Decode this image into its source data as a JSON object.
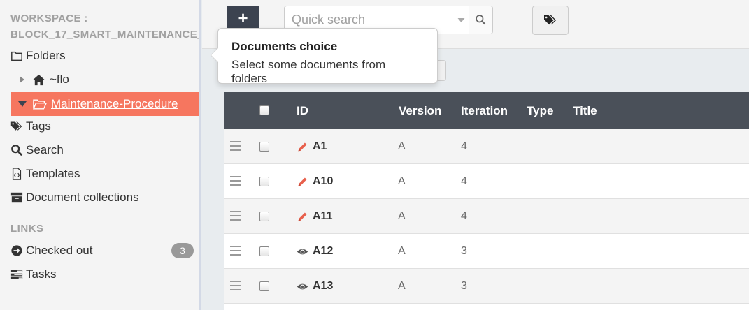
{
  "workspace": {
    "title_line1": "WORKSPACE :",
    "title_line2": "BLOCK_17_SMART_MAINTENANCE_"
  },
  "sidebar": {
    "folders_label": "Folders",
    "tree": [
      {
        "label": "~flo",
        "icon": "home-icon",
        "expanded": false
      },
      {
        "label": "Maintenance-Procedure",
        "icon": "folder-open-icon",
        "expanded": true,
        "active": true
      }
    ],
    "items": [
      {
        "label": "Tags",
        "icon": "tags-icon"
      },
      {
        "label": "Search",
        "icon": "search-icon"
      },
      {
        "label": "Templates",
        "icon": "file-code-icon"
      },
      {
        "label": "Document collections",
        "icon": "archive-icon"
      }
    ],
    "links_header": "LINKS",
    "links": [
      {
        "label": "Checked out",
        "icon": "arrow-circle-right-icon",
        "badge": "3"
      },
      {
        "label": "Tasks",
        "icon": "tasks-icon"
      }
    ]
  },
  "toolbar": {
    "new_label": "+",
    "search_placeholder": "Quick search"
  },
  "popover": {
    "title": "Documents choice",
    "body": "Select some documents from folders"
  },
  "table": {
    "headers": {
      "id": "ID",
      "version": "Version",
      "iteration": "Iteration",
      "type": "Type",
      "title": "Title"
    },
    "rows": [
      {
        "id": "A1",
        "status_icon": "pencil-icon",
        "version": "A",
        "iteration": "4",
        "type": "",
        "title": ""
      },
      {
        "id": "A10",
        "status_icon": "pencil-icon",
        "version": "A",
        "iteration": "4",
        "type": "",
        "title": ""
      },
      {
        "id": "A11",
        "status_icon": "pencil-icon",
        "version": "A",
        "iteration": "4",
        "type": "",
        "title": ""
      },
      {
        "id": "A12",
        "status_icon": "eye-icon",
        "version": "A",
        "iteration": "3",
        "type": "",
        "title": ""
      },
      {
        "id": "A13",
        "status_icon": "eye-icon",
        "version": "A",
        "iteration": "3",
        "type": "",
        "title": ""
      }
    ]
  },
  "colors": {
    "active_folder": "#f6765f",
    "header_bg": "#4a5059",
    "pencil": "#e8604c"
  }
}
